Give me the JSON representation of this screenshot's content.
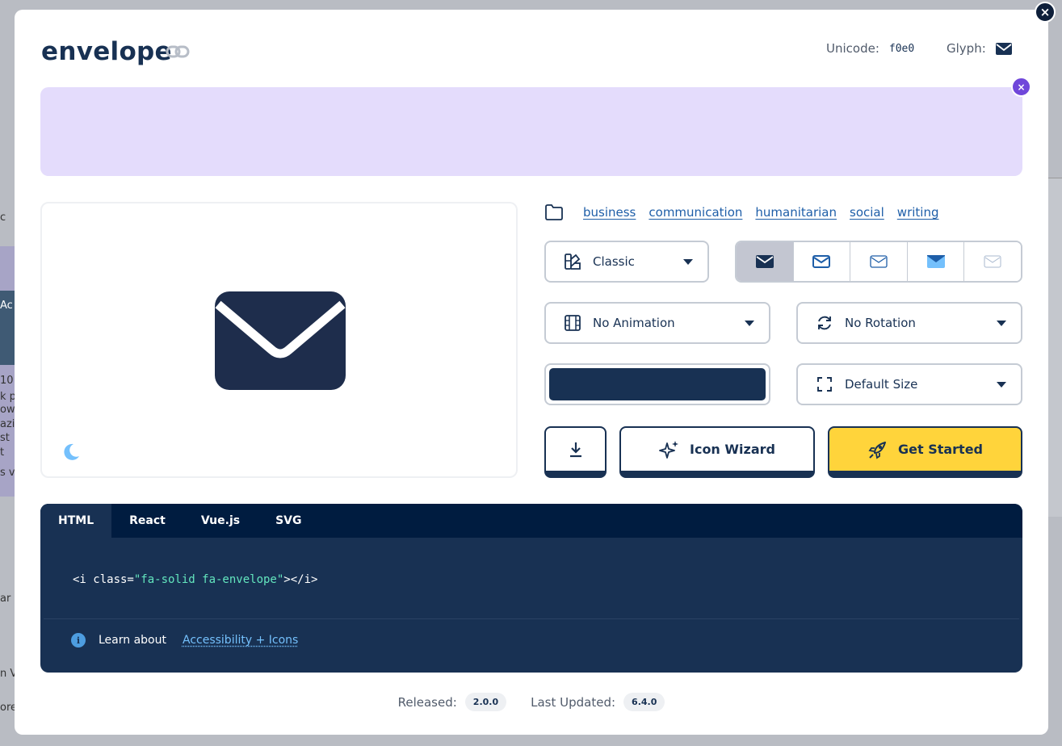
{
  "backdrop": {
    "left_text": [
      "c",
      "Ac",
      "10",
      "k p",
      "ow",
      "azi",
      "st",
      "t",
      "s v",
      "ar",
      "n V",
      "ore"
    ]
  },
  "modal": {
    "close_label": "×",
    "title": "envelope",
    "unicode_label": "Unicode:",
    "unicode_value": "f0e0",
    "glyph_label": "Glyph:"
  },
  "ad": {
    "close_label": "×"
  },
  "tags": {
    "items": [
      "business",
      "communication",
      "humanitarian",
      "social",
      "writing"
    ]
  },
  "controls": {
    "family": "Classic",
    "animation": "No Animation",
    "rotation": "No Rotation",
    "size": "Default Size",
    "color": "#183153",
    "style_options": [
      "solid",
      "regular",
      "light",
      "duotone",
      "thin"
    ]
  },
  "buttons": {
    "wizard": "Icon Wizard",
    "get_started": "Get Started"
  },
  "code": {
    "tabs": [
      "HTML",
      "React",
      "Vue.js",
      "SVG"
    ],
    "active_tab": "HTML",
    "line_prefix": "<i class=",
    "line_value": "\"fa-solid fa-envelope\"",
    "line_suffix": "></i>",
    "learn_label": "Learn about",
    "learn_link": "Accessibility + Icons",
    "info_glyph": "i"
  },
  "footer": {
    "released_label": "Released:",
    "released_value": "2.0.0",
    "updated_label": "Last Updated:",
    "updated_value": "6.4.0"
  },
  "colors": {
    "navy": "#183153",
    "yellow": "#ffd43b",
    "ad_bg": "#e4dcfc",
    "ad_close": "#7047da",
    "code_bg": "#183153",
    "code_string": "#63e6be"
  }
}
